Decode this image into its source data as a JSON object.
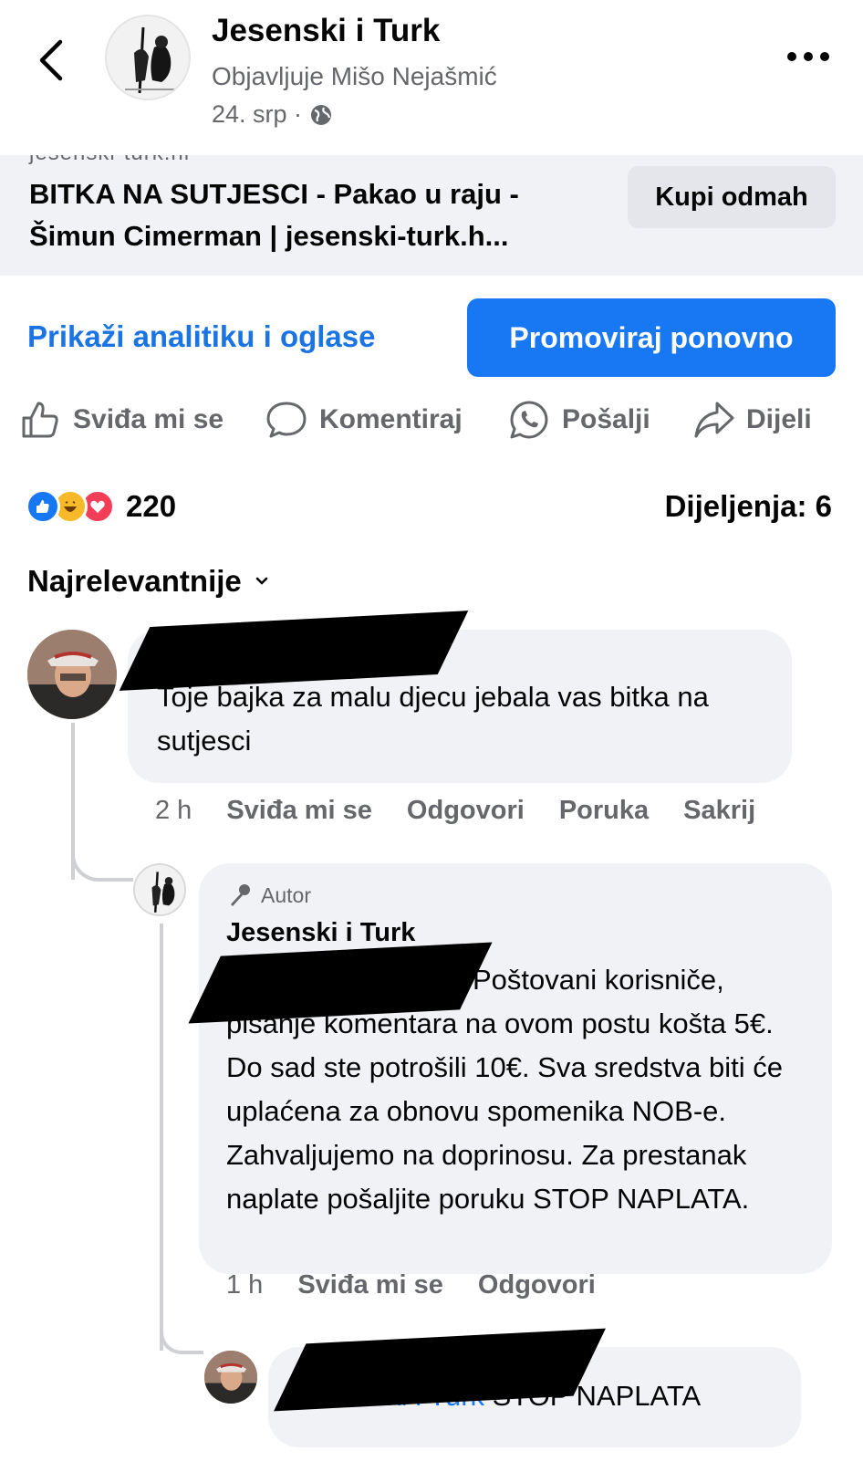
{
  "header": {
    "page_name": "Jesenski i Turk",
    "posted_by": "Objavljuje Mišo Nejašmić",
    "date": "24. srp ·"
  },
  "link_preview": {
    "domain": "jesenski-turk.hr",
    "title": "BITKA NA SUTJESCI - Pakao u raju - Šimun Cimerman | jesenski-turk.h...",
    "cta": "Kupi odmah"
  },
  "actions": {
    "analytics": "Prikaži analitiku i oglase",
    "promote": "Promoviraj ponovno",
    "like": "Sviđa mi se",
    "comment": "Komentiraj",
    "send": "Pošalji",
    "share": "Dijeli"
  },
  "stats": {
    "reaction_count": "220",
    "shares": "Dijeljenja: 6"
  },
  "sort_label": "Najrelevantnije",
  "comments": [
    {
      "text": "Toje bajka za malu djecu jebala vas bitka na sutjesci",
      "time": "2 h",
      "like": "Sviđa mi se",
      "reply": "Odgovori",
      "message": "Poruka",
      "hide": "Sakrij"
    },
    {
      "badge": "Autor",
      "author": "Jesenski i Turk",
      "text": "Poštovani korisniče, pisanje komentara na ovom postu košta 5€. Do sad ste potrošili 10€. Sva sredstva biti će uplaćena za obnovu spomenika NOB-e. Zahvaljujemo na doprinosu. Za prestanak naplate pošaljite poruku STOP NAPLATA.",
      "time": "1 h",
      "like": "Sviđa mi se",
      "reply": "Odgovori"
    },
    {
      "mention": "Jesenski i Turk",
      "text": "STOP NAPLATA"
    }
  ],
  "colors": {
    "accent": "#1877f2",
    "link": "#1b74e4",
    "secondary_text": "#65676b",
    "bubble": "#f0f2f5"
  }
}
